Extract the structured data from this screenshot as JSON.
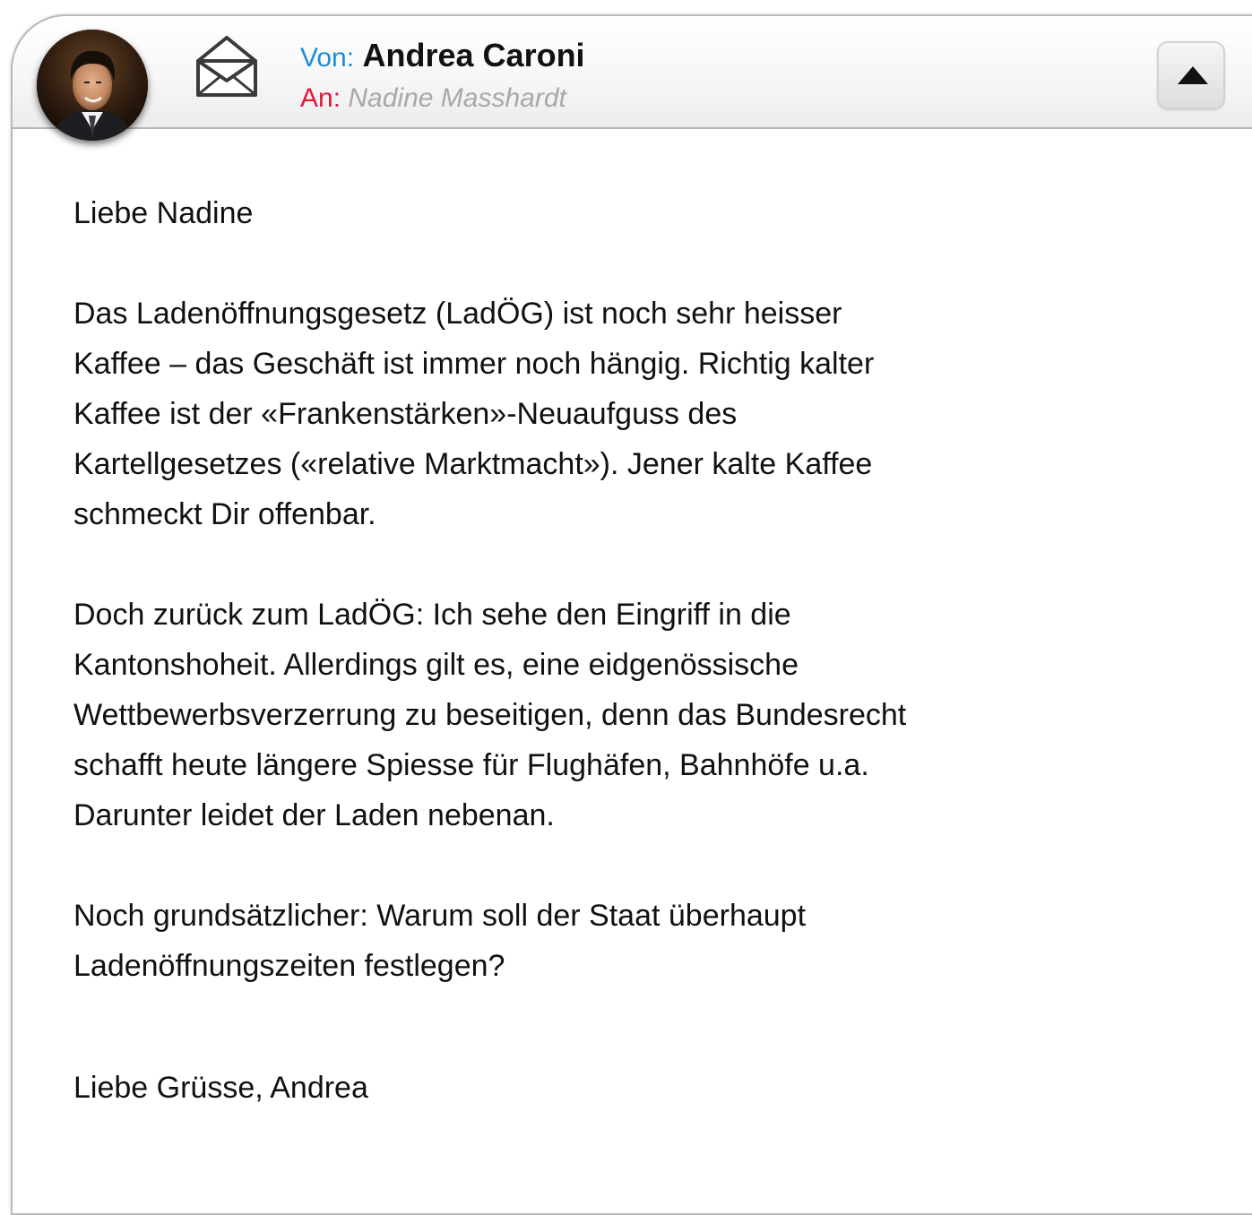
{
  "header": {
    "from_label": "Von:",
    "from_name": "Andrea Caroni",
    "to_label": "An:",
    "to_name": "Nadine Masshardt",
    "avatar_icon": "avatar-photo",
    "envelope_icon": "open-envelope-icon",
    "collapse_icon": "triangle-up-icon"
  },
  "body": {
    "greeting": "Liebe Nadine",
    "paragraph_1": "Das Ladenöffnungsgesetz (LadÖG) ist noch sehr heisser\nKaffee – das Geschäft ist immer noch hängig. Richtig kalter\nKaffee ist der «Frankenstärken»-Neuaufguss des\nKartellgesetzes («relative Marktmacht»). Jener kalte Kaffee\nschmeckt Dir offenbar.",
    "paragraph_2": "Doch zurück zum LadÖG: Ich sehe den Eingriff in die\nKantonshoheit. Allerdings gilt es, eine eidgenössische\nWettbewerbsverzerrung zu beseitigen, denn das Bundesrecht\nschafft heute längere Spiesse für Flughäfen, Bahnhöfe u.a.\nDarunter leidet der Laden nebenan.",
    "paragraph_3": "Noch grundsätzlicher: Warum soll der Staat überhaupt\nLadenöffnungszeiten festlegen?",
    "closing": "Liebe Grüsse, Andrea"
  },
  "colors": {
    "from_label": "#1c8ed6",
    "to_label": "#e0183a",
    "to_name": "#a8a8a8"
  }
}
